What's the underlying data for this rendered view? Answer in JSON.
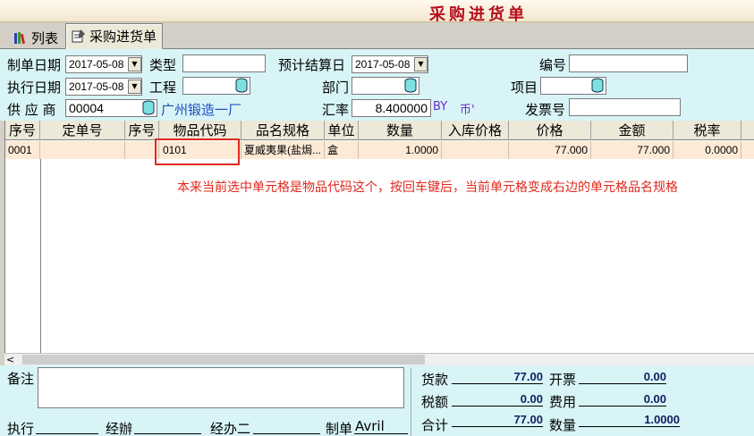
{
  "window": {
    "title": "采购进货单"
  },
  "tabs": [
    {
      "label": "列表"
    },
    {
      "label": "采购进货单"
    }
  ],
  "form": {
    "make_date": {
      "label": "制单日期",
      "value": "2017-05-08"
    },
    "type": {
      "label": "类型",
      "value": ""
    },
    "settle_date": {
      "label": "预计结算日",
      "value": "2017-05-08"
    },
    "number": {
      "label": "编号",
      "value": ""
    },
    "exec_date": {
      "label": "执行日期",
      "value": "2017-05-08"
    },
    "project_work": {
      "label": "工程",
      "value": ""
    },
    "dept": {
      "label": "部门",
      "value": ""
    },
    "item": {
      "label": "项目",
      "value": ""
    },
    "supplier": {
      "label": "供 应 商",
      "value": "00004",
      "name": "广州锻造一厂"
    },
    "rate": {
      "label": "汇率",
      "value": "8.400000",
      "currency": "BY",
      "currency2": "币'"
    },
    "invoice": {
      "label": "发票号",
      "value": ""
    }
  },
  "grid": {
    "columns": [
      "序号",
      "定单号",
      "序号",
      "物品代码",
      "品名规格",
      "单位",
      "数量",
      "入库价格",
      "价格",
      "金额",
      "税率"
    ],
    "rows": [
      {
        "seq": "0001",
        "order_no": "",
        "seq2": "",
        "code": "0101",
        "spec": "夏威夷果(盐焗...",
        "unit": "盒",
        "qty": "1.0000",
        "in_price": "",
        "price": "77.000",
        "amount": "77.000",
        "tax": "0.0000"
      }
    ],
    "annotation": "本来当前选中单元格是物品代码这个，按回车键后，当前单元格变成右边的单元格品名规格"
  },
  "footer": {
    "memo_label": "备注",
    "memo_value": "",
    "exec_label": "执行",
    "handler_label": "经辦",
    "handler2_label": "经办二",
    "maker_label": "制单",
    "maker_value": "Avril",
    "goods_label": "货款",
    "goods_value": "77.00",
    "invoice_label": "开票",
    "invoice_value": "0.00",
    "tax_label": "税额",
    "tax_value": "0.00",
    "fee_label": "费用",
    "fee_value": "0.00",
    "total_label": "合计",
    "total_value": "77.00",
    "qty_label": "数量",
    "qty_value": "1.0000"
  }
}
